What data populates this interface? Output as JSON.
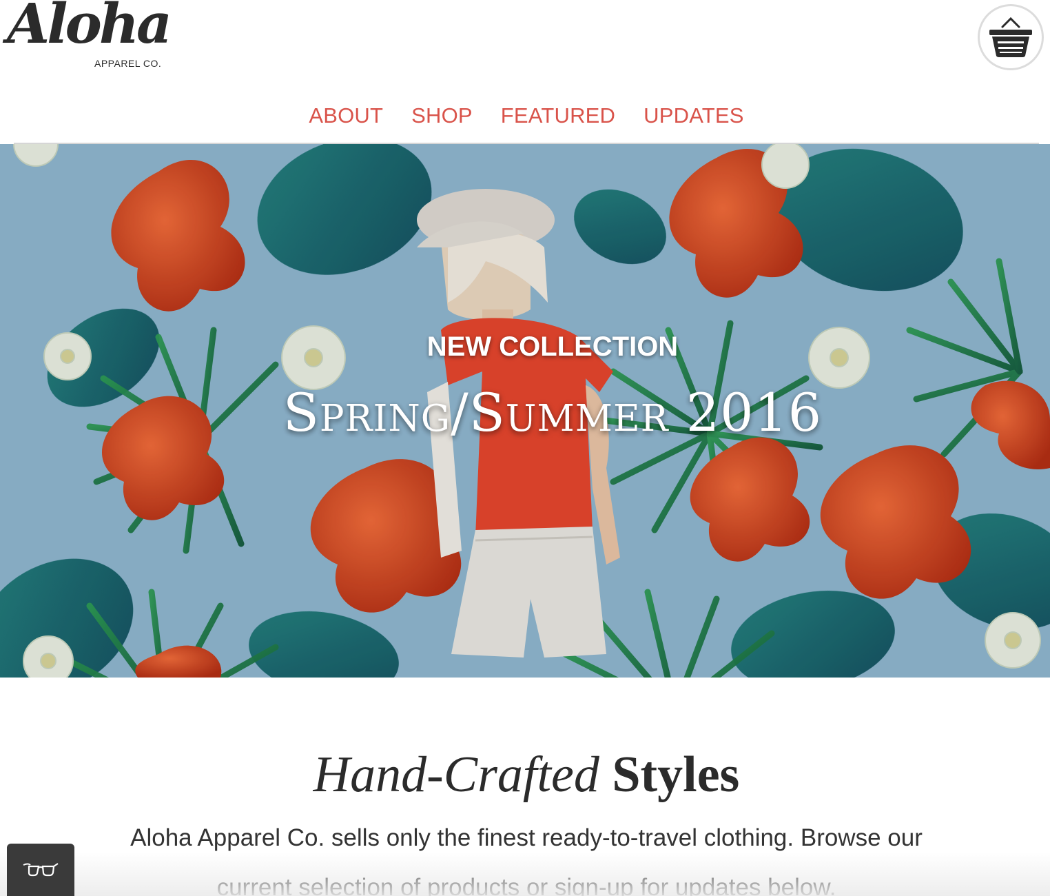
{
  "logo": {
    "script": "Aloha",
    "sub": "APPAREL CO."
  },
  "cart": {
    "icon": "basket-icon"
  },
  "nav": {
    "items": [
      {
        "label": "ABOUT"
      },
      {
        "label": "SHOP"
      },
      {
        "label": "FEATURED"
      },
      {
        "label": "UPDATES"
      }
    ]
  },
  "hero": {
    "kicker": "NEW COLLECTION",
    "title": "Spring/Summer 2016"
  },
  "content": {
    "heading_em": "Hand-Crafted",
    "heading_strong": "Styles",
    "intro": "Aloha Apparel Co. sells only the finest ready-to-travel clothing. Browse our current selection of products or sign-up for updates below."
  },
  "accessibility": {
    "icon": "glasses-icon"
  },
  "colors": {
    "accent": "#d9534a",
    "text": "#2b2b2b",
    "hero_bg": "#8fb6cf"
  }
}
